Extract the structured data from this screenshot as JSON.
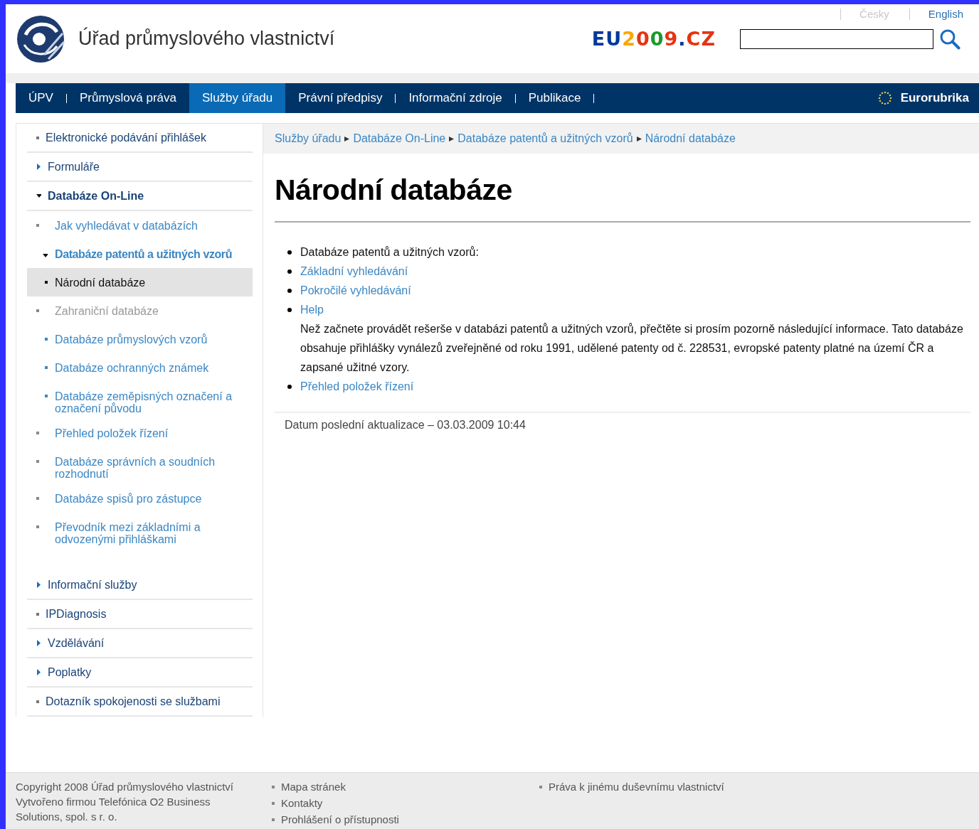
{
  "header": {
    "site_title": "Úřad průmyslového vlastnictví",
    "languages": [
      {
        "label": "Česky",
        "selected": true
      },
      {
        "label": "English",
        "selected": false
      }
    ],
    "eu_logo": "EU2009.CZ"
  },
  "nav": {
    "tabs": [
      {
        "label": "ÚPV",
        "selected": false
      },
      {
        "label": "Průmyslová práva",
        "selected": false
      },
      {
        "label": "Služby úřadu",
        "selected": true
      },
      {
        "label": "Právní předpisy",
        "selected": false
      },
      {
        "label": "Informační zdroje",
        "selected": false
      },
      {
        "label": "Publikace",
        "selected": false
      }
    ],
    "eurorubrika": "Eurorubrika"
  },
  "sidebar": {
    "items": [
      {
        "label": "Elektronické podávání přihlášek",
        "kind": "bullet",
        "selected": false
      },
      {
        "label": "Formuláře",
        "kind": "collapsed",
        "selected": false
      },
      {
        "label": "Databáze On-Line",
        "kind": "expanded",
        "selected": false,
        "children": [
          {
            "label": "Jak vyhledávat v databázích",
            "kind": "bullet",
            "selected": false
          },
          {
            "label": "Databáze patentů a užitných vzorů",
            "kind": "expanded",
            "selected": false,
            "children": [
              {
                "label": "Národní databáze",
                "selected": true,
                "disabled": false
              },
              {
                "label": "Zahraniční databáze",
                "selected": false,
                "disabled": true
              }
            ]
          },
          {
            "label": "Databáze průmyslových vzorů",
            "kind": "inset",
            "selected": false
          },
          {
            "label": "Databáze ochranných známek",
            "kind": "inset",
            "selected": false
          },
          {
            "label": "Databáze zeměpisných označení a označení původu",
            "kind": "inset",
            "selected": false
          },
          {
            "label": "Přehled položek řízení",
            "kind": "bullet",
            "selected": false
          },
          {
            "label": "Databáze správních a soudních rozhodnutí",
            "kind": "bullet",
            "selected": false
          },
          {
            "label": "Databáze spisů pro zástupce",
            "kind": "bullet",
            "selected": false
          },
          {
            "label": "Převodník mezi základními a odvozenými přihláškami",
            "kind": "bullet",
            "selected": false
          }
        ]
      },
      {
        "label": "Informační služby",
        "kind": "collapsed",
        "selected": false
      },
      {
        "label": "IPDiagnosis",
        "kind": "bullet",
        "selected": false
      },
      {
        "label": "Vzdělávání",
        "kind": "collapsed",
        "selected": false
      },
      {
        "label": "Poplatky",
        "kind": "collapsed",
        "selected": false
      },
      {
        "label": "Dotazník spokojenosti se službami",
        "kind": "bullet",
        "selected": false
      }
    ]
  },
  "breadcrumb": [
    "Služby úřadu",
    "Databáze On-Line",
    "Databáze patentů a užitných vzorů",
    "Národní databáze"
  ],
  "content": {
    "title": "Národní databáze",
    "list": [
      {
        "kind": "text",
        "text": "Databáze patentů a užitných vzorů:"
      },
      {
        "kind": "link",
        "text": "Základní vyhledávání"
      },
      {
        "kind": "link",
        "text": "Pokročilé vyhledávání"
      },
      {
        "kind": "link",
        "text": "Help",
        "note": "Než začnete provádět rešerše v databázi patentů a užitných vzorů, přečtěte si prosím pozorně následující informace. Tato databáze obsahuje přihlášky vynálezů zveřejněné od roku 1991, udělené patenty od č. 228531, evropské patenty platné na území ČR a zapsané užitné vzory."
      },
      {
        "kind": "link",
        "text": "Přehled položek řízení"
      }
    ],
    "updated": "Datum poslední aktualizace – 03.03.2009 10:44"
  },
  "footer": {
    "copyright": [
      "Copyright 2008 Úřad průmyslového vlastnictví",
      "Vytvořeno firmou Telefónica O2 Business Solutions, spol. s r. o."
    ],
    "columns": [
      [
        "Mapa stránek",
        "Kontakty",
        "Prohlášení o přístupnosti"
      ],
      [
        "Práva k jinému duševnímu vlastnictví"
      ]
    ]
  }
}
